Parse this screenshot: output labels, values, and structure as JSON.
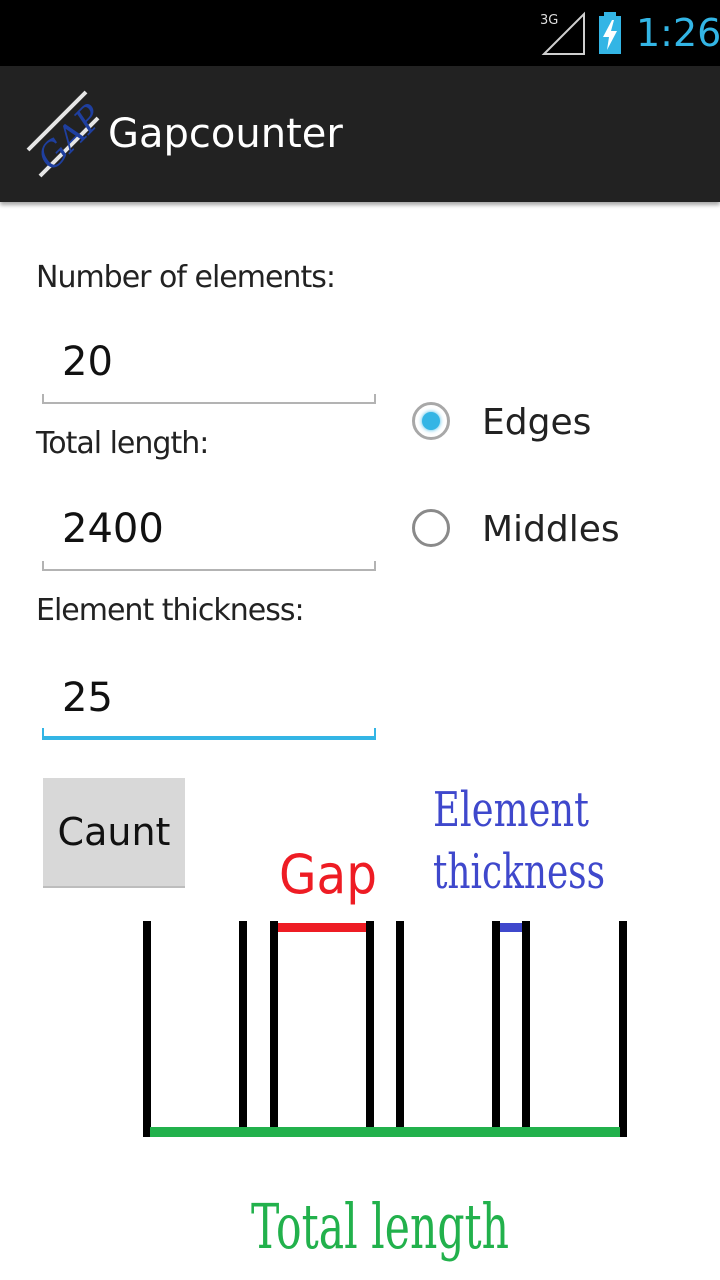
{
  "status_bar": {
    "network": "3G",
    "time": "1:26"
  },
  "action_bar": {
    "title": "Gapcounter",
    "icon": "gap-logo-icon",
    "logo_text": "GAP"
  },
  "form": {
    "elements_label": "Number of elements:",
    "elements_value": "20",
    "length_label": "Total length:",
    "length_value": "2400",
    "thickness_label": "Element thickness:",
    "thickness_value": "25"
  },
  "mode": {
    "options": [
      {
        "label": "Edges",
        "selected": true
      },
      {
        "label": "Middles",
        "selected": false
      }
    ]
  },
  "count_button": {
    "label": "Caunt"
  },
  "diagram": {
    "gap_label": "Gap",
    "thickness_label_line1": "Element",
    "thickness_label_line2": "thickness",
    "total_label": "Total length",
    "colors": {
      "gap": "#ee1c24",
      "thickness": "#3f48cc",
      "total": "#22b14c",
      "element": "#000000"
    }
  },
  "colors": {
    "accent": "#33b5e5",
    "action_bar": "#222222",
    "status_bar": "#000000"
  }
}
